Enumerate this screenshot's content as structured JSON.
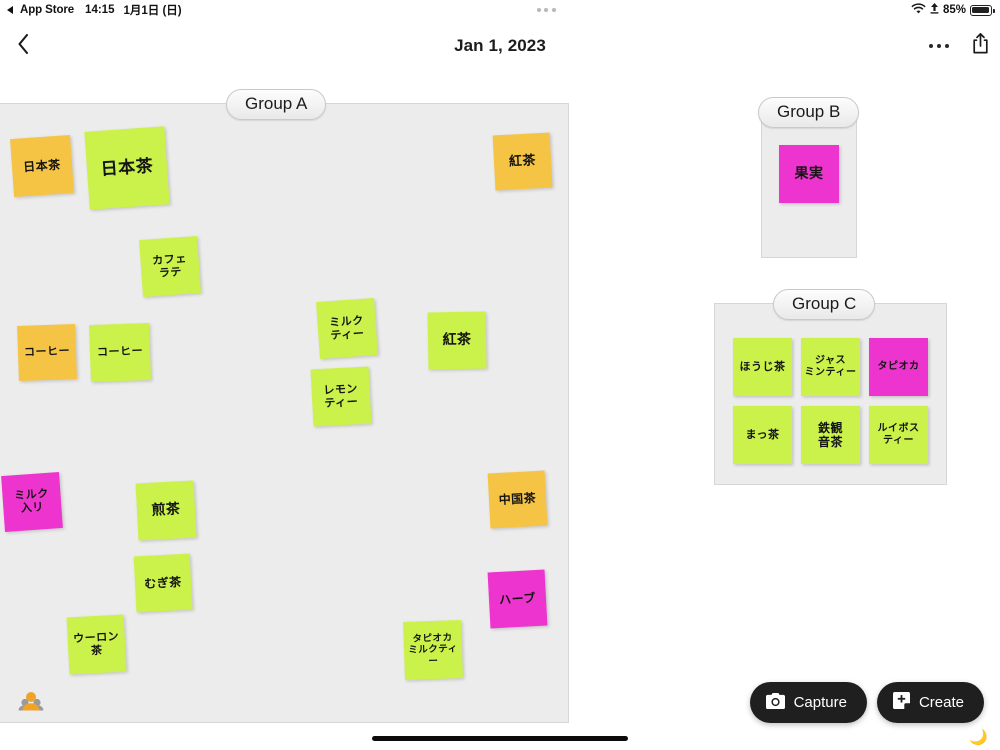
{
  "statusbar": {
    "back_app": "App Store",
    "time": "14:15",
    "date": "1月1日 (日)",
    "battery_pct": "85%",
    "wifi_icon": "wifi-icon",
    "location_icon": "location-arrow-icon",
    "battery_icon": "battery-icon",
    "multitask_icon": "multitask-handle-icon"
  },
  "navbar": {
    "back_icon": "chevron-left-icon",
    "title": "Jan 1, 2023",
    "more_icon": "more-horizontal-icon",
    "share_icon": "share-icon"
  },
  "groups": [
    {
      "id": "a",
      "label": "Group A"
    },
    {
      "id": "b",
      "label": "Group B"
    },
    {
      "id": "c",
      "label": "Group C"
    }
  ],
  "colors": {
    "note_green": "#cbf24a",
    "note_orange": "#f6c445",
    "note_magenta": "#ee34ce",
    "group_bg": "#ececec",
    "canvas_bg": "#ffffff",
    "fab_bg": "#1f1f1f"
  },
  "notes_group_a": [
    {
      "text": "日本茶",
      "color": "orange"
    },
    {
      "text": "日本茶",
      "color": "green"
    },
    {
      "text": "カフェ\nラテ",
      "color": "green"
    },
    {
      "text": "紅茶",
      "color": "orange"
    },
    {
      "text": "コーヒー",
      "color": "orange"
    },
    {
      "text": "コーヒー",
      "color": "green"
    },
    {
      "text": "ミルク\nティー",
      "color": "green"
    },
    {
      "text": "紅茶",
      "color": "green"
    },
    {
      "text": "レモン\nティー",
      "color": "green"
    },
    {
      "text": "ミルク\n入リ",
      "color": "magenta"
    },
    {
      "text": "煎茶",
      "color": "green"
    },
    {
      "text": "むぎ茶",
      "color": "green"
    },
    {
      "text": "ウーロン\n茶",
      "color": "green"
    },
    {
      "text": "中国茶",
      "color": "orange"
    },
    {
      "text": "ハーブ",
      "color": "magenta"
    },
    {
      "text": "タピオカ\nミルクティー",
      "color": "green"
    }
  ],
  "notes_group_b": [
    {
      "text": "果実",
      "color": "magenta"
    }
  ],
  "notes_group_c": [
    {
      "text": "ほうじ茶",
      "color": "green"
    },
    {
      "text": "ジャス\nミンティー",
      "color": "green"
    },
    {
      "text": "タピオカ",
      "color": "magenta"
    },
    {
      "text": "まっ茶",
      "color": "green"
    },
    {
      "text": "鉄観\n音茶",
      "color": "green"
    },
    {
      "text": "ルイボス\nティー",
      "color": "green"
    }
  ],
  "toolbar": {
    "capture_label": "Capture",
    "capture_icon": "camera-icon",
    "create_label": "Create",
    "create_icon": "new-note-icon",
    "collaborators_icon": "people-icon"
  }
}
